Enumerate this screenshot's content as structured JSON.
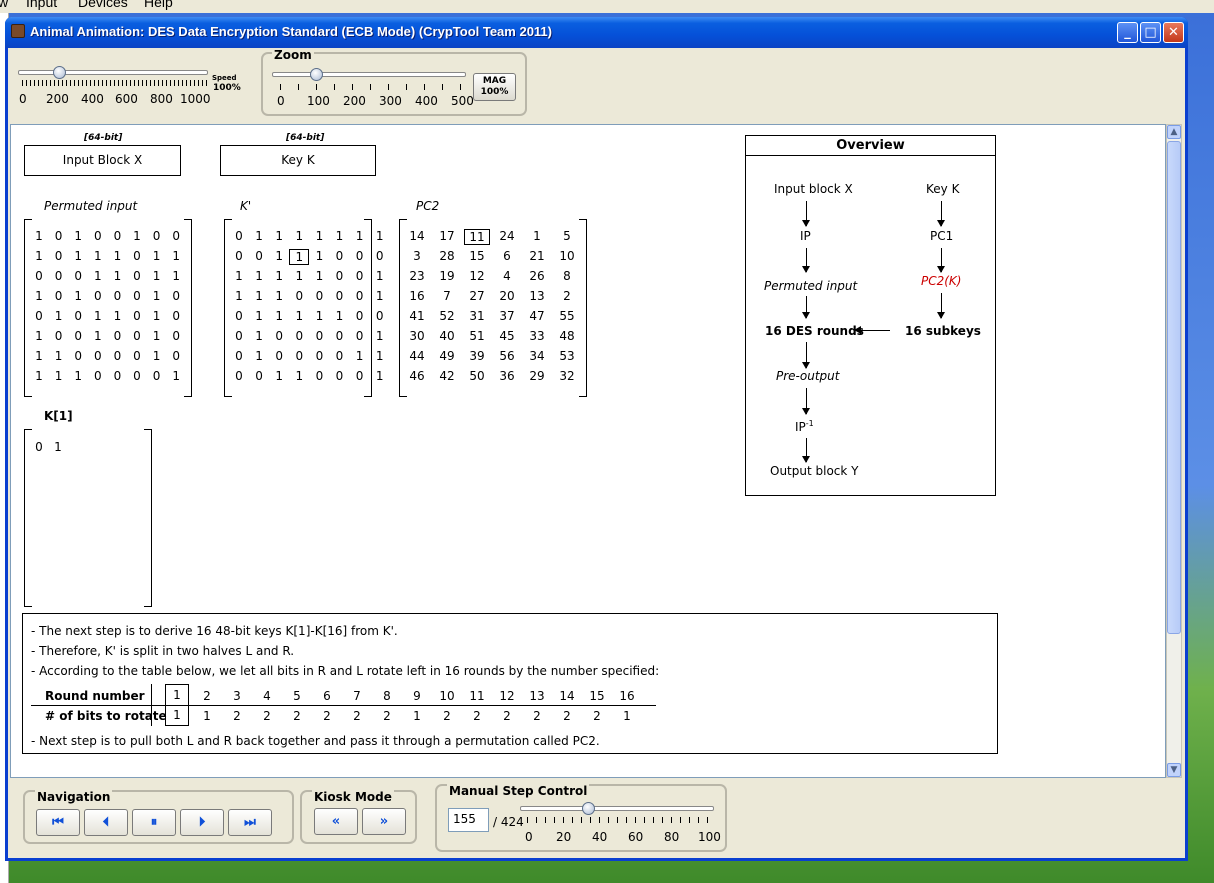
{
  "menu": {
    "items": [
      "w",
      "Input",
      "Devices",
      "Help"
    ]
  },
  "window": {
    "title": "Animal Animation: DES Data Encryption Standard (ECB Mode) (CrypTool Team 2011)",
    "controls": {
      "minimize": "_",
      "maximize": "□",
      "close": "✕"
    }
  },
  "speed": {
    "label": "Speed",
    "value_label": "100%",
    "value": 100,
    "ticks": [
      "0",
      "200",
      "400",
      "600",
      "800",
      "1000"
    ]
  },
  "zoom": {
    "title": "Zoom",
    "mag_label": "MAG",
    "mag_value": "100%",
    "value": 100,
    "ticks": [
      "0",
      "100",
      "200",
      "300",
      "400",
      "500"
    ]
  },
  "blocks": {
    "input_tag": "[64-bit]",
    "input_label": "Input Block X",
    "key_tag": "[64-bit]",
    "key_label": "Key K"
  },
  "permuted_input": {
    "title": "Permuted input",
    "rows": [
      [
        "1",
        "0",
        "1",
        "0",
        "0",
        "1",
        "0",
        "0"
      ],
      [
        "1",
        "0",
        "1",
        "1",
        "1",
        "0",
        "1",
        "1"
      ],
      [
        "0",
        "0",
        "0",
        "1",
        "1",
        "0",
        "1",
        "1"
      ],
      [
        "1",
        "0",
        "1",
        "0",
        "0",
        "0",
        "1",
        "0"
      ],
      [
        "0",
        "1",
        "0",
        "1",
        "1",
        "0",
        "1",
        "0"
      ],
      [
        "1",
        "0",
        "0",
        "1",
        "0",
        "0",
        "1",
        "0"
      ],
      [
        "1",
        "1",
        "0",
        "0",
        "0",
        "0",
        "1",
        "0"
      ],
      [
        "1",
        "1",
        "1",
        "0",
        "0",
        "0",
        "0",
        "1"
      ]
    ]
  },
  "k_prime": {
    "title": "K'",
    "highlight": [
      1,
      3
    ],
    "rows": [
      [
        "0",
        "1",
        "1",
        "1",
        "1",
        "1",
        "1",
        "1"
      ],
      [
        "0",
        "0",
        "1",
        "1",
        "1",
        "0",
        "0",
        "0"
      ],
      [
        "1",
        "1",
        "1",
        "1",
        "1",
        "0",
        "0",
        "1"
      ],
      [
        "1",
        "1",
        "1",
        "0",
        "0",
        "0",
        "0",
        "1"
      ],
      [
        "0",
        "1",
        "1",
        "1",
        "1",
        "1",
        "0",
        "0"
      ],
      [
        "0",
        "1",
        "0",
        "0",
        "0",
        "0",
        "0",
        "1"
      ],
      [
        "0",
        "1",
        "0",
        "0",
        "0",
        "0",
        "1",
        "1"
      ],
      [
        "0",
        "0",
        "1",
        "1",
        "0",
        "0",
        "0",
        "1"
      ]
    ]
  },
  "pc2": {
    "title": "PC2",
    "highlight": [
      0,
      2
    ],
    "rows": [
      [
        "14",
        "17",
        "11",
        "24",
        "1",
        "5"
      ],
      [
        "3",
        "28",
        "15",
        "6",
        "21",
        "10"
      ],
      [
        "23",
        "19",
        "12",
        "4",
        "26",
        "8"
      ],
      [
        "16",
        "7",
        "27",
        "20",
        "13",
        "2"
      ],
      [
        "41",
        "52",
        "31",
        "37",
        "47",
        "55"
      ],
      [
        "30",
        "40",
        "51",
        "45",
        "33",
        "48"
      ],
      [
        "44",
        "49",
        "39",
        "56",
        "34",
        "53"
      ],
      [
        "46",
        "42",
        "50",
        "36",
        "29",
        "32"
      ]
    ]
  },
  "k1": {
    "title": "K[1]",
    "values": [
      "0",
      "1"
    ]
  },
  "overview": {
    "title": "Overview",
    "input_block": "Input block X",
    "key": "Key K",
    "ip": "IP",
    "pc1": "PC1",
    "permuted_input": "Permuted input",
    "pc2k": "PC2(K)",
    "des_rounds": "16 DES rounds",
    "subkeys": "16 subkeys",
    "pre_output": "Pre-output",
    "ip_inv": "IP",
    "ip_inv_sup": "-1",
    "output_block": "Output block Y",
    "highlight_color": "#cc0000"
  },
  "description": {
    "lines": [
      "- The next step is to derive 16 48-bit keys K[1]-K[16] from K'.",
      "- Therefore, K' is split in two halves L and R.",
      "- According to the table below, we let all bits in R and L rotate left in 16 rounds by the number specified:"
    ],
    "final_line": "- Next step is to pull both L and R back together and pass it through a permutation called PC2.",
    "round_header": "Round number",
    "bits_header": "# of bits to rotate",
    "rounds": [
      "1",
      "2",
      "3",
      "4",
      "5",
      "6",
      "7",
      "8",
      "9",
      "10",
      "11",
      "12",
      "13",
      "14",
      "15",
      "16"
    ],
    "bits": [
      "1",
      "1",
      "2",
      "2",
      "2",
      "2",
      "2",
      "2",
      "1",
      "2",
      "2",
      "2",
      "2",
      "2",
      "2",
      "1"
    ]
  },
  "navigation": {
    "title": "Navigation",
    "buttons": [
      "⏮",
      "⏴",
      "⏸",
      "⏵",
      "⏭"
    ]
  },
  "kiosk": {
    "title": "Kiosk Mode",
    "buttons": [
      "«",
      "»"
    ]
  },
  "manual": {
    "title": "Manual Step Control",
    "step": "155",
    "total": "/ 424",
    "progress": 34,
    "ticks": [
      "0",
      "20",
      "40",
      "60",
      "80",
      "100"
    ]
  }
}
